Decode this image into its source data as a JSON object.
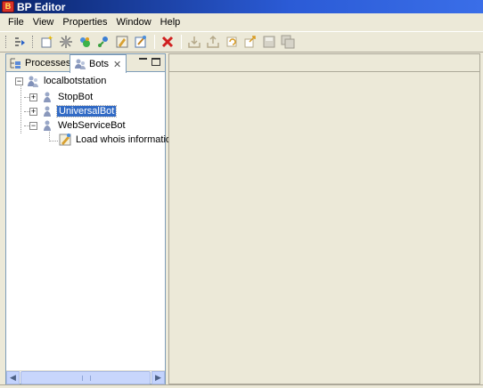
{
  "window": {
    "title": "BP Editor",
    "app_icon": "bp-editor-icon"
  },
  "menubar": {
    "items": [
      "File",
      "View",
      "Properties",
      "Window",
      "Help"
    ]
  },
  "toolbar": {
    "buttons": [
      {
        "icon": "run-process-icon"
      },
      {
        "icon": "new-process-icon"
      },
      {
        "icon": "deploy-icon"
      },
      {
        "icon": "bot-config-icon"
      },
      {
        "icon": "connect-icon"
      },
      {
        "icon": "edit-properties-icon"
      },
      {
        "icon": "wizard-icon"
      },
      {
        "icon": "delete-icon",
        "color": "#d02020"
      },
      {
        "icon": "import-icon"
      },
      {
        "icon": "export-icon"
      },
      {
        "icon": "refresh-icon"
      },
      {
        "icon": "publish-icon"
      },
      {
        "icon": "save-icon"
      },
      {
        "icon": "save-all-icon"
      }
    ]
  },
  "left_view": {
    "tabs": [
      {
        "label": "Processes",
        "icon": "processes-icon",
        "active": false
      },
      {
        "label": "Bots",
        "icon": "bots-icon",
        "active": true,
        "close_glyph": "✕"
      }
    ],
    "tree": {
      "root": {
        "label": "localbotstation",
        "icon": "botstation-icon",
        "expanded": true
      },
      "children": [
        {
          "label": "StopBot",
          "icon": "bot-icon",
          "expanded": false,
          "selected": false
        },
        {
          "label": "UniversalBot",
          "icon": "bot-icon",
          "expanded": false,
          "selected": true
        },
        {
          "label": "WebServiceBot",
          "icon": "bot-icon",
          "expanded": true,
          "selected": false,
          "children": [
            {
              "label": "Load whois information",
              "icon": "task-icon"
            }
          ]
        }
      ]
    }
  },
  "colors": {
    "selection": "#316ac5",
    "titlebar": "#0a246a",
    "chrome": "#ece9d8"
  }
}
